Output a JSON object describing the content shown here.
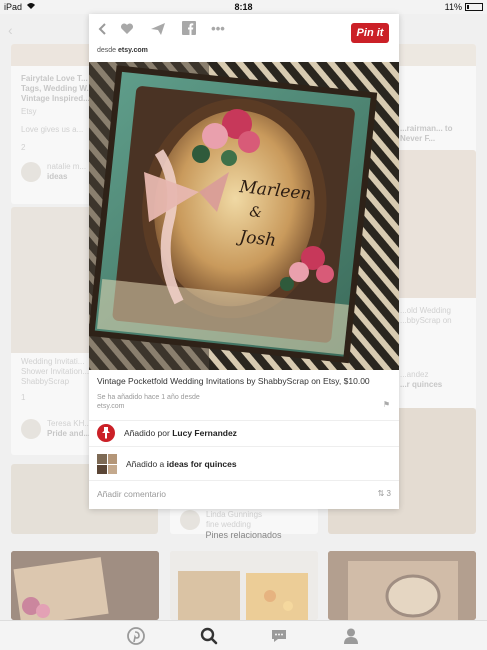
{
  "status_bar": {
    "device": "iPad",
    "time": "8:18",
    "battery": "11%"
  },
  "modal": {
    "source_prefix": "desde",
    "source_domain": "etsy.com",
    "pin_button": "Pin it",
    "description": "Vintage Pocketfold Wedding Invitations by ShabbyScrap on Etsy, $10.00",
    "saved_meta": "Se ha añadido hace 1 año desde",
    "saved_meta_domain": "etsy.com",
    "added_by_prefix": "Añadido por",
    "added_by_name": "Lucy Fernandez",
    "added_to_prefix": "Añadido a",
    "added_to_board": "ideas for quinces",
    "add_comment": "Añadir comentario",
    "repin_count": "3",
    "image_script_names": "Marleen & Josh"
  },
  "feed": {
    "left_col": [
      {
        "title": "Fairytale Love T... Tags, Wedding W... Vintage Inspired...",
        "source": "Etsy",
        "desc": "Love gives us a...",
        "count": "2",
        "user": "natalie m...",
        "board": "ideas"
      },
      {
        "title": "Wedding Invitati... Shower Invitation... ShabbyScrap",
        "count": "1",
        "user": "Teresa KH...",
        "board": "Pride and..."
      }
    ],
    "right_col": [
      {
        "title": "...rairman... to Never F...",
        "user": ""
      },
      {
        "title": "...old Wedding ...bbyScrap on",
        "user": "...andez",
        "board": "...r quinces"
      }
    ],
    "center_card": {
      "user": "Linda Gunnings",
      "board": "fine wedding"
    },
    "related_label": "Pines relacionados"
  }
}
